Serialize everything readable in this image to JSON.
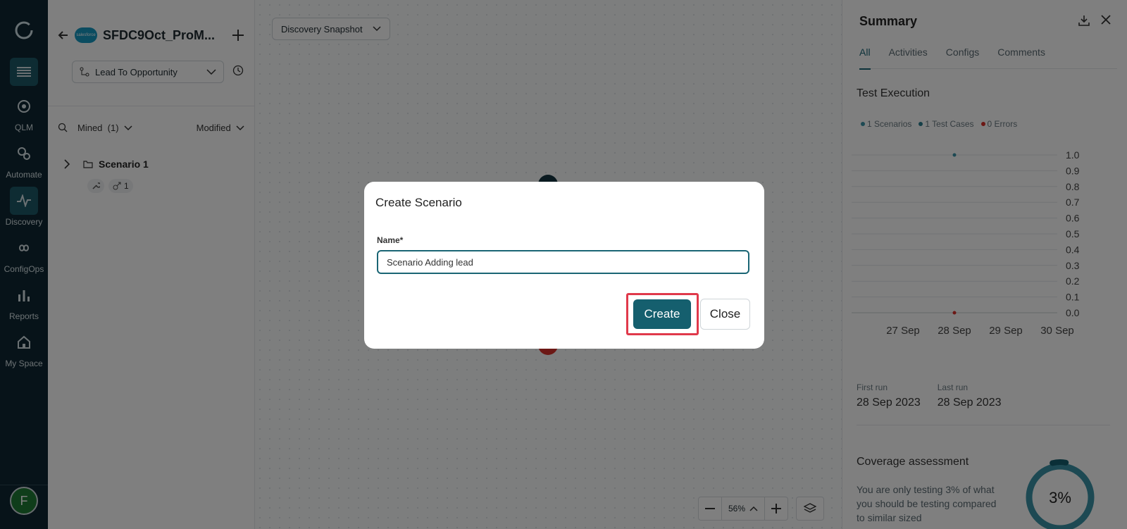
{
  "nav": {
    "items": [
      {
        "label": "QLM",
        "icon": "target-icon"
      },
      {
        "label": "Automate",
        "icon": "gears-icon"
      },
      {
        "label": "Discovery",
        "icon": "pulse-icon",
        "active": true
      },
      {
        "label": "ConfigOps",
        "icon": "infinity-icon"
      },
      {
        "label": "Reports",
        "icon": "bar-chart-icon"
      },
      {
        "label": "My Space",
        "icon": "home-icon"
      }
    ],
    "avatar_initial": "F"
  },
  "panel": {
    "title": "SFDC9Oct_ProM...",
    "flow_selected": "Lead To Opportunity",
    "filter_label": "Mined",
    "filter_count": "(1)",
    "sort_label": "Modified",
    "tree": {
      "scenario_name": "Scenario 1",
      "link_count": "1"
    }
  },
  "canvas": {
    "snapshot_label": "Discovery Snapshot",
    "zoom_level": "56%"
  },
  "summary": {
    "title": "Summary",
    "tabs": [
      "All",
      "Activities",
      "Configs",
      "Comments"
    ],
    "test_execution_title": "Test Execution",
    "legend": [
      {
        "label": "1 Scenarios",
        "color": "#3a93a6"
      },
      {
        "label": "1 Test Cases",
        "color": "#2b7d8e"
      },
      {
        "label": "0 Errors",
        "color": "#d9302b"
      }
    ],
    "first_run_label": "First run",
    "first_run_value": "28 Sep 2023",
    "last_run_label": "Last run",
    "last_run_value": "28 Sep 2023",
    "coverage_title": "Coverage assessment",
    "coverage_text": "You are only testing 3% of what you should be testing compared to similar sized",
    "coverage_value": "3%",
    "coverage_fraction": 0.03
  },
  "chart_data": {
    "type": "scatter",
    "x": [
      "27 Sep",
      "28 Sep",
      "29 Sep",
      "30 Sep"
    ],
    "y_ticks": [
      "1.0",
      "0.9",
      "0.8",
      "0.7",
      "0.6",
      "0.5",
      "0.4",
      "0.3",
      "0.2",
      "0.1",
      "0.0"
    ],
    "ylim": [
      0,
      1
    ],
    "series": [
      {
        "color": "#3a93a6",
        "points": [
          {
            "x": "28 Sep",
            "y": 1.0
          }
        ]
      },
      {
        "color": "#d9302b",
        "points": [
          {
            "x": "28 Sep",
            "y": 0.0
          }
        ]
      }
    ],
    "grid": true
  },
  "modal": {
    "title": "Create Scenario",
    "name_label": "Name*",
    "name_value": "Scenario Adding lead",
    "create_label": "Create",
    "close_label": "Close"
  }
}
